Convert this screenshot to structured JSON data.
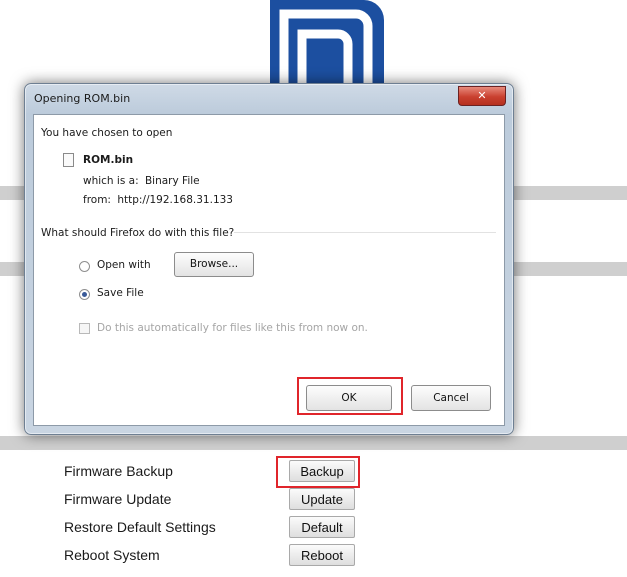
{
  "page": {
    "logo_icon": "brand-logo-icon",
    "brand_color": "#1c4fa0",
    "settings": [
      {
        "label": "Firmware Backup",
        "button": "Backup"
      },
      {
        "label": "Firmware Update",
        "button": "Update"
      },
      {
        "label": "Restore Default Settings",
        "button": "Default"
      },
      {
        "label": "Reboot System",
        "button": "Reboot"
      }
    ],
    "highlight_color": "#e0252b"
  },
  "dialog": {
    "title": "Opening ROM.bin",
    "close_icon": "close-icon",
    "intro": "You have chosen to open",
    "file_name": "ROM.bin",
    "type_prefix": "which is a:",
    "type_value": "Binary File",
    "from_prefix": "from:",
    "from_value": "http://192.168.31.133",
    "question": "What should Firefox do with this file?",
    "open_with_label": "Open with",
    "browse_label": "Browse...",
    "save_file_label": "Save File",
    "save_file_selected": true,
    "auto_label": "Do this automatically for files like this from now on.",
    "ok_label": "OK",
    "cancel_label": "Cancel"
  }
}
